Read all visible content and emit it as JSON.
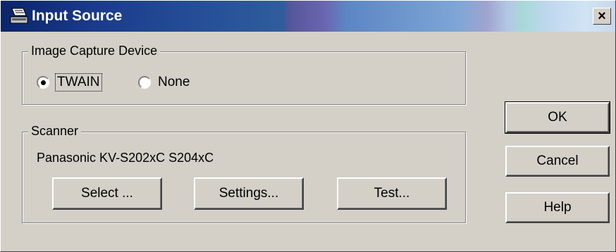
{
  "window": {
    "title": "Input Source",
    "close_glyph": "×"
  },
  "capture_group": {
    "legend": "Image Capture Device",
    "options": [
      {
        "label": "TWAIN",
        "checked": true
      },
      {
        "label": "None",
        "checked": false
      }
    ]
  },
  "scanner_group": {
    "legend": "Scanner",
    "device_name": "Panasonic KV-S202xC S204xC",
    "buttons": {
      "select": "Select ...",
      "settings": "Settings...",
      "test": "Test..."
    }
  },
  "dialog_buttons": {
    "ok": "OK",
    "cancel": "Cancel",
    "help": "Help"
  },
  "icons": {
    "app": "scanner-icon",
    "close": "close-icon"
  }
}
